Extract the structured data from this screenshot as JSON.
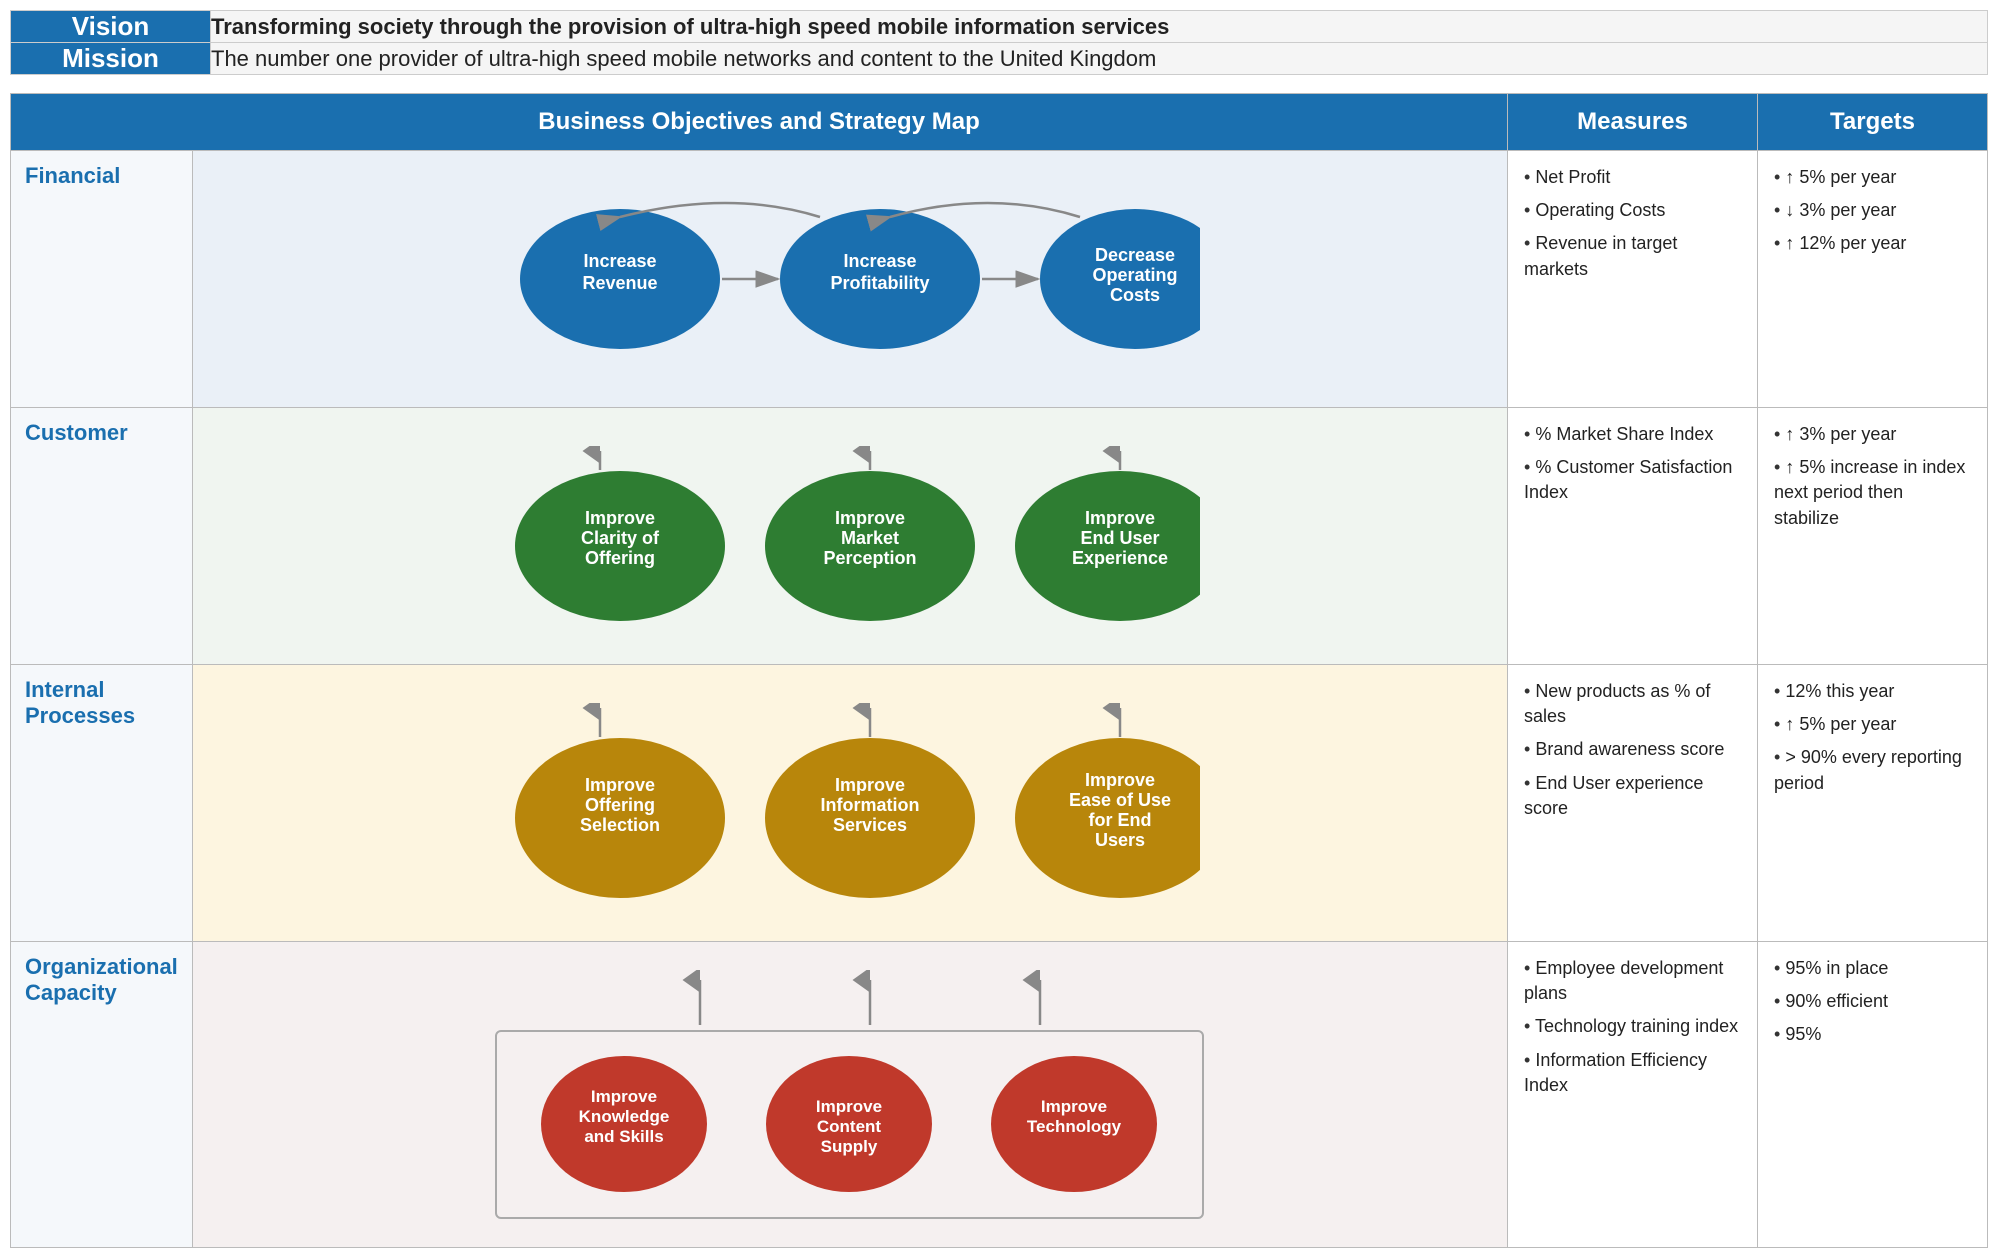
{
  "vision": {
    "label": "Vision",
    "text": "Transforming society through the provision of ultra-high speed mobile information services"
  },
  "mission": {
    "label": "Mission",
    "text": "The number one provider of ultra-high speed mobile networks and content to the United Kingdom"
  },
  "header": {
    "objectives_label": "Business Objectives and Strategy Map",
    "measures_label": "Measures",
    "targets_label": "Targets"
  },
  "rows": {
    "financial": {
      "label": "Financial",
      "nodes": [
        {
          "text": "Increase\nRevenue"
        },
        {
          "text": "Increase\nProfitability"
        },
        {
          "text": "Decrease\nOperating\nCosts"
        }
      ],
      "measures": [
        "Net Profit",
        "Operating Costs",
        "Revenue in target markets"
      ],
      "targets": [
        "↑ 5% per year",
        "↓ 3% per year",
        "↑ 12% per year"
      ]
    },
    "customer": {
      "label": "Customer",
      "nodes": [
        {
          "text": "Improve\nClarity of\nOffering"
        },
        {
          "text": "Improve\nMarket\nPerception"
        },
        {
          "text": "Improve\nEnd User\nExperience"
        }
      ],
      "measures": [
        "% Market Share Index",
        "% Customer Satisfaction Index"
      ],
      "targets": [
        "↑ 3% per year",
        "↑ 5% increase in index next period then stabilize"
      ]
    },
    "internal": {
      "label": "Internal\nProcesses",
      "nodes": [
        {
          "text": "Improve\nOffering\nSelection"
        },
        {
          "text": "Improve\nInformation\nServices"
        },
        {
          "text": "Improve\nEase of Use\nfor End\nUsers"
        }
      ],
      "measures": [
        "New products as % of sales",
        "Brand awareness score",
        "End User experience score"
      ],
      "targets": [
        "12% this year",
        "↑ 5% per year",
        "> 90% every reporting period"
      ]
    },
    "org": {
      "label": "Organizational\nCapacity",
      "nodes": [
        {
          "text": "Improve\nKnowledge\nand Skills"
        },
        {
          "text": "Improve\nContent\nSupply"
        },
        {
          "text": "Improve\nTechnology"
        }
      ],
      "measures": [
        "Employee development plans",
        "Technology training index",
        "Information Efficiency Index"
      ],
      "targets": [
        "95% in place",
        "90% efficient",
        "95%"
      ]
    }
  }
}
